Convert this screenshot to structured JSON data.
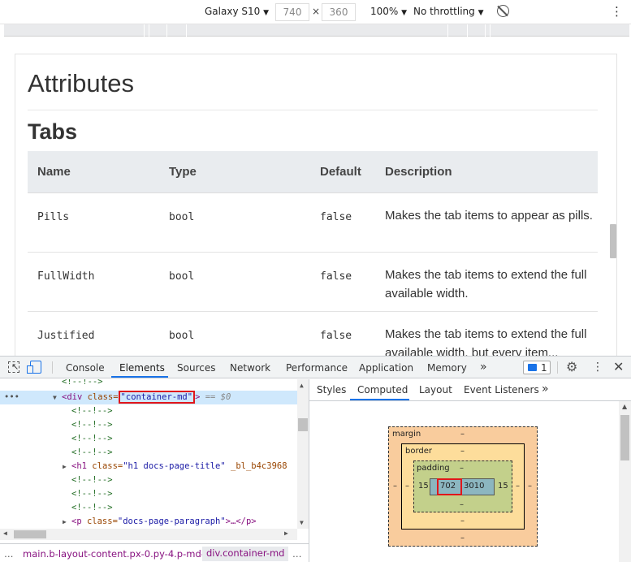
{
  "device_toolbar": {
    "device": "Galaxy S10",
    "width": "740",
    "height": "360",
    "times": "×",
    "zoom": "100%",
    "throttling": "No throttling",
    "caret": "▼"
  },
  "page": {
    "heading": "Attributes",
    "subheading": "Tabs",
    "table": {
      "headers": [
        "Name",
        "Type",
        "Default",
        "Description"
      ],
      "rows": [
        {
          "name": "Pills",
          "type": "bool",
          "default": "false",
          "description": "Makes the tab items to appear as pills."
        },
        {
          "name": "FullWidth",
          "type": "bool",
          "default": "false",
          "description": "Makes the tab items to extend the full available width."
        },
        {
          "name": "Justified",
          "type": "bool",
          "default": "false",
          "description": "Makes the tab items to extend the full available width, but every item..."
        }
      ]
    }
  },
  "devtools": {
    "tabs": [
      "Console",
      "Elements",
      "Sources",
      "Network",
      "Performance",
      "Application",
      "Memory"
    ],
    "active_tab": "Elements",
    "more": "»",
    "message_count": "1",
    "elements": {
      "comment": "<!--!-->",
      "selected": {
        "open": "<div ",
        "attr_name": "class=",
        "attr_value": "\"container-md\"",
        "close": ">",
        "marker": "== $0",
        "dots": "•••"
      },
      "h1_line": {
        "open": "<h1 ",
        "attr_name": "class=",
        "attr_value": "\"h1 docs-page-title\"",
        "rest": " _bl_b4c3968"
      },
      "p_line": {
        "open": "<p ",
        "attr_name": "class=",
        "attr_value": "\"docs-page-paragraph\"",
        "rest": ">…</p>"
      }
    },
    "breadcrumb": {
      "more": "…",
      "items": [
        "main.b-layout-content.px-0.py-4.p-md-4",
        "div.container-md"
      ],
      "tail": "…"
    },
    "styles": {
      "tabs": [
        "Styles",
        "Computed",
        "Layout",
        "Event Listeners"
      ],
      "active_tab": "Computed",
      "more": "»",
      "box_model": {
        "margin_label": "margin",
        "border_label": "border",
        "padding_label": "padding",
        "margin_top": "–",
        "margin_bottom": "–",
        "margin_left": "–",
        "margin_right": "–",
        "border_top": "–",
        "border_bottom": "–",
        "border_left": "–",
        "border_right": "–",
        "padding_top": "–",
        "padding_bottom": "–",
        "padding_left": "15",
        "padding_right": "15",
        "content_width": "702",
        "content_height": "3010"
      }
    }
  },
  "colors": {
    "highlight_red": "#e0161b",
    "accent_blue": "#1a73e8"
  }
}
